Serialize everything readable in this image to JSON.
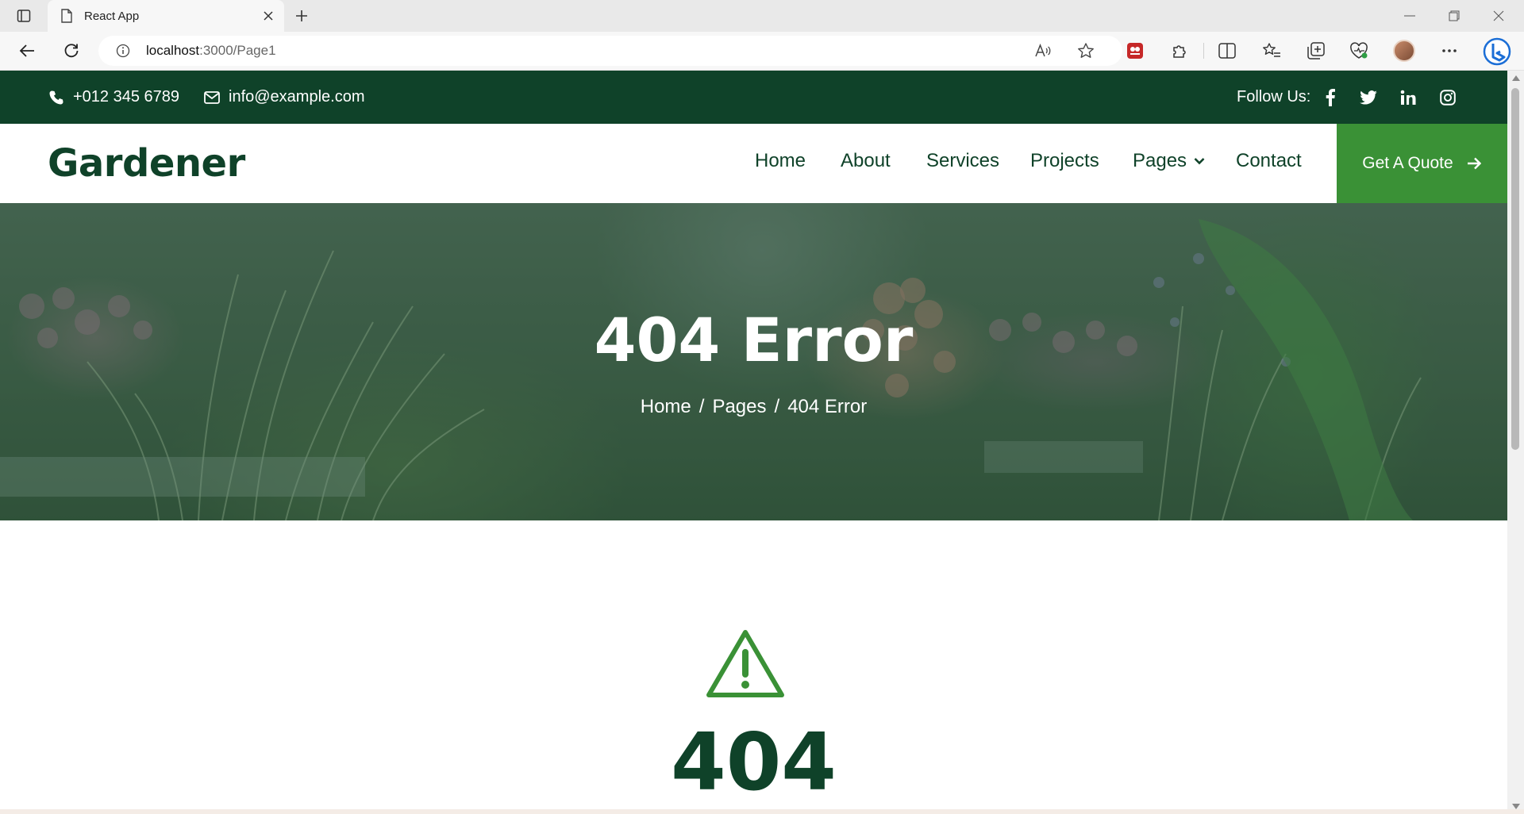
{
  "browser": {
    "tab_title": "React App",
    "url_host": "localhost",
    "url_path": ":3000/Page1"
  },
  "topbar": {
    "phone": "+012 345 6789",
    "email": "info@example.com",
    "follow_label": "Follow Us:",
    "socials": [
      "facebook-icon",
      "twitter-icon",
      "linkedin-icon",
      "instagram-icon"
    ]
  },
  "navbar": {
    "brand": "Gardener",
    "items": [
      "Home",
      "About",
      "Services",
      "Projects",
      "Pages",
      "Contact"
    ],
    "quote_label": "Get A Quote"
  },
  "hero": {
    "title": "404 Error",
    "breadcrumb": [
      "Home",
      "Pages",
      "404 Error"
    ]
  },
  "content": {
    "code": "404"
  },
  "colors": {
    "dark_green": "#0f4229",
    "accent_green": "#3a9136"
  }
}
